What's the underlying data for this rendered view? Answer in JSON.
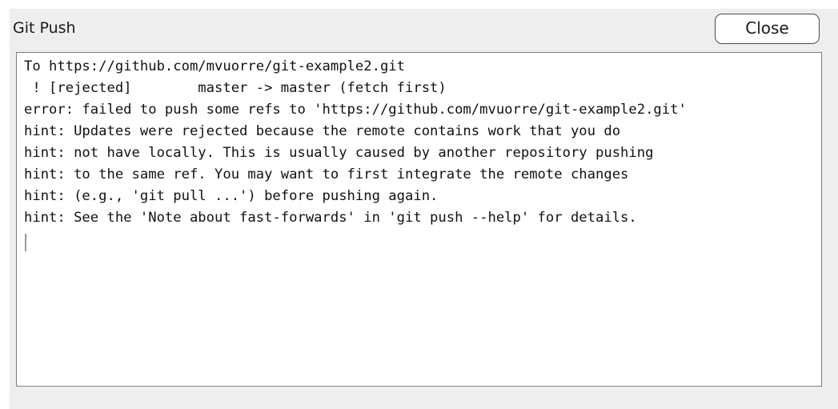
{
  "dialog": {
    "title": "Git Push",
    "close_label": "Close"
  },
  "console": {
    "lines": [
      "To https://github.com/mvuorre/git-example2.git",
      " ! [rejected]        master -> master (fetch first)",
      "error: failed to push some refs to 'https://github.com/mvuorre/git-example2.git'",
      "hint: Updates were rejected because the remote contains work that you do",
      "hint: not have locally. This is usually caused by another repository pushing",
      "hint: to the same ref. You may want to first integrate the remote changes",
      "hint: (e.g., 'git pull ...') before pushing again.",
      "hint: See the 'Note about fast-forwards' in 'git push --help' for details."
    ]
  }
}
